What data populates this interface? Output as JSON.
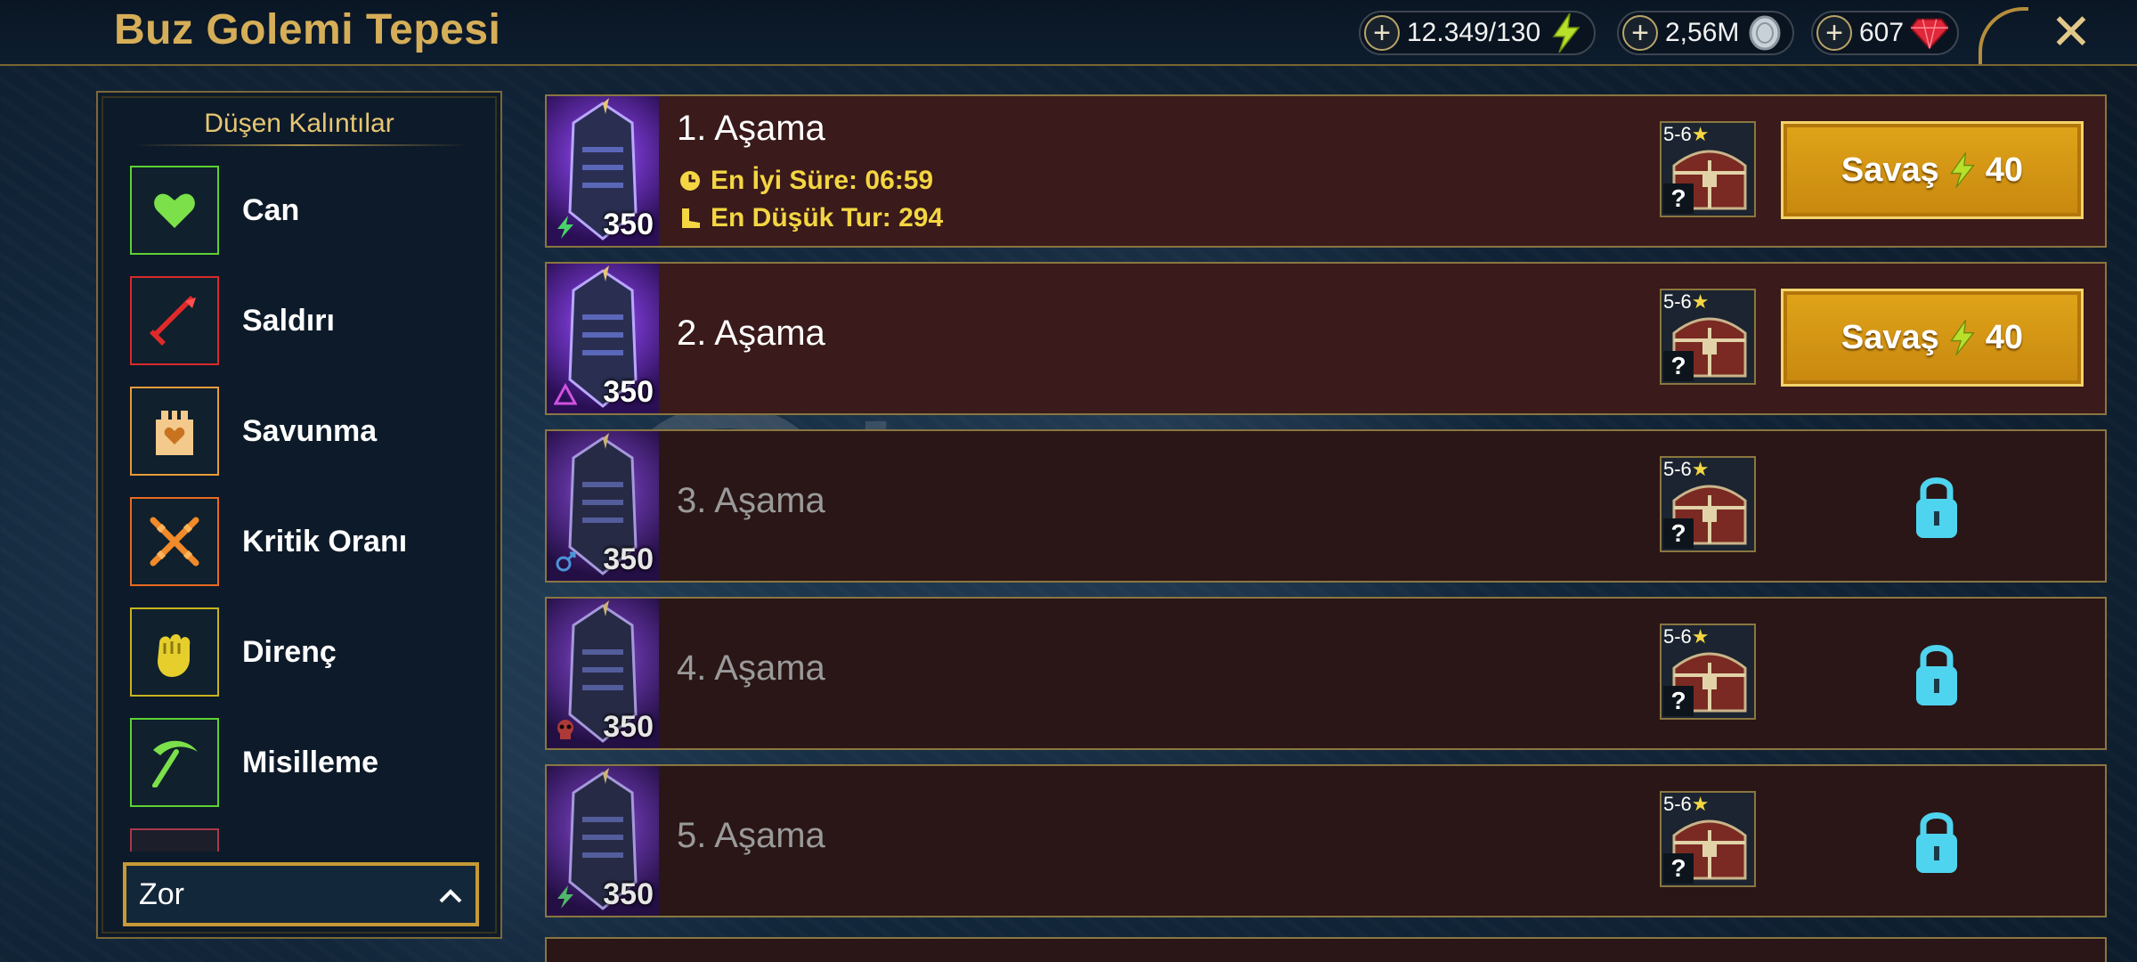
{
  "header": {
    "title": "Buz Golemi Tepesi",
    "energy": "12.349/130",
    "silver": "2,56M",
    "gems": "607",
    "close_label": "✕"
  },
  "left_panel": {
    "heading": "Düşen Kalıntılar",
    "sets": [
      {
        "label": "Can",
        "icon": "heart-icon",
        "border": "#5dd233"
      },
      {
        "label": "Saldırı",
        "icon": "sword-icon",
        "border": "#d82a2a"
      },
      {
        "label": "Savunma",
        "icon": "castle-icon",
        "border": "#e89b3a"
      },
      {
        "label": "Kritik Oranı",
        "icon": "crossed-swords-icon",
        "border": "#e86a1f"
      },
      {
        "label": "Direnç",
        "icon": "fist-icon",
        "border": "#c8b31e"
      },
      {
        "label": "Misilleme",
        "icon": "pickaxe-icon",
        "border": "#5dd233"
      }
    ],
    "difficulty": "Zor"
  },
  "stages": [
    {
      "name": "1. Aşama",
      "level": "350",
      "affinity": "force",
      "best_time_label": "En İyi Süre: 06:59",
      "min_turns_label": "En Düşük Tur: 294",
      "rewards": "5-6",
      "battle_label": "Savaş",
      "cost": "40",
      "locked": false
    },
    {
      "name": "2. Aşama",
      "level": "350",
      "affinity": "void",
      "rewards": "5-6",
      "battle_label": "Savaş",
      "cost": "40",
      "locked": false
    },
    {
      "name": "3. Aşama",
      "level": "350",
      "affinity": "magic",
      "rewards": "5-6",
      "locked": true
    },
    {
      "name": "4. Aşama",
      "level": "350",
      "affinity": "spirit",
      "rewards": "5-6",
      "locked": true
    },
    {
      "name": "5. Aşama",
      "level": "350",
      "affinity": "force",
      "rewards": "5-6",
      "locked": true
    }
  ],
  "watermark": {
    "text": "itemsatış",
    "sub": "HESAP / SKIN / ITEM / E-PIN .com"
  },
  "colors": {
    "gold": "#d6ae58",
    "energy": "#b8e02a",
    "lock": "#4fd4ef",
    "stat_yellow": "#f3d642"
  }
}
